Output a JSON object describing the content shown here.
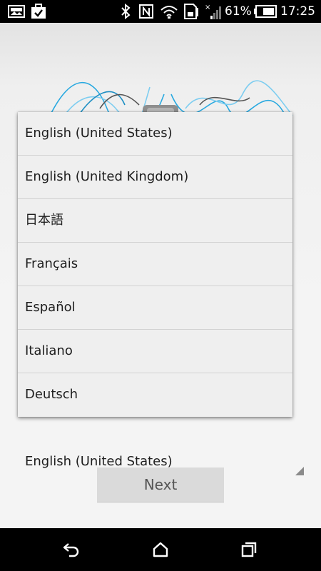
{
  "status_bar": {
    "icons_left": [
      "gallery-icon",
      "briefcase-check-icon"
    ],
    "icons_right": [
      "bluetooth-icon",
      "nfc-icon",
      "wifi-icon",
      "sd-card-icon",
      "signal-icon"
    ],
    "battery_percent": "61%",
    "battery_level": 0.61,
    "time": "17:25"
  },
  "setup": {
    "selected_language": "English (United States)",
    "next_label": "Next",
    "accent_color": "#29a9e0"
  },
  "dropdown": {
    "items": [
      "English (United States)",
      "English (United Kingdom)",
      "日本語",
      "Français",
      "Español",
      "Italiano",
      "Deutsch"
    ]
  },
  "nav_bar": {
    "buttons": [
      "back-icon",
      "home-icon",
      "recents-icon"
    ]
  }
}
